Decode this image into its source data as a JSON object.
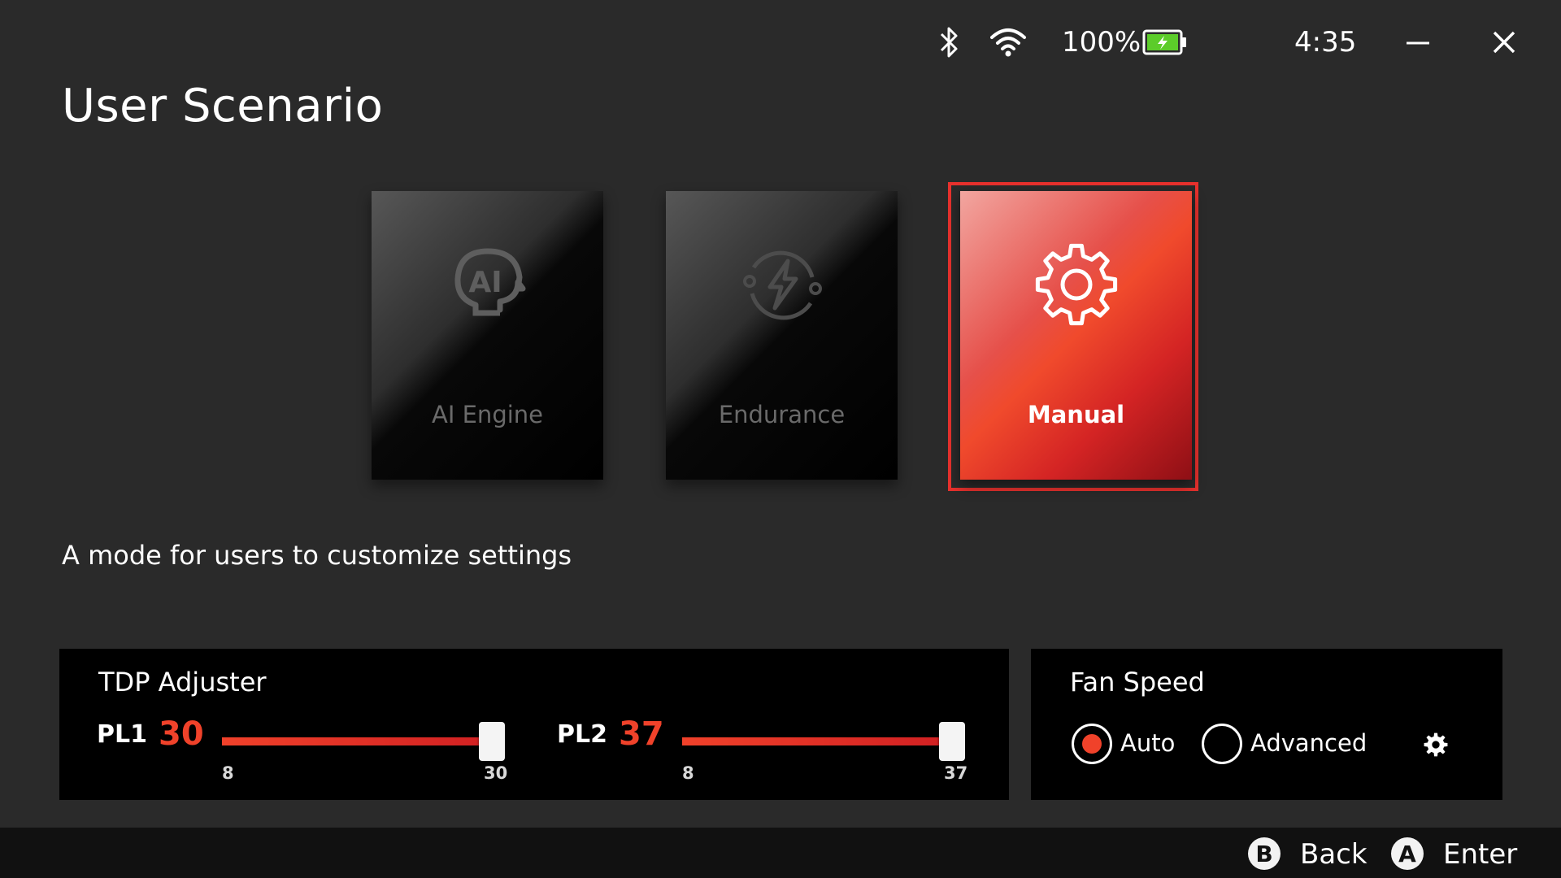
{
  "status_bar": {
    "battery_text": "100%",
    "time": "4:35",
    "icons": [
      "bluetooth-icon",
      "wifi-icon",
      "battery-charging-icon",
      "minimize-icon",
      "close-icon"
    ]
  },
  "page": {
    "title": "User Scenario",
    "description": "A mode for users to customize settings"
  },
  "modes": [
    {
      "label": "AI Engine",
      "icon": "ai-engine-icon",
      "selected": false
    },
    {
      "label": "Endurance",
      "icon": "endurance-icon",
      "selected": false
    },
    {
      "label": "Manual",
      "icon": "gear-icon",
      "selected": true
    }
  ],
  "tdp": {
    "title": "TDP Adjuster",
    "pl1": {
      "label": "PL1",
      "value": "30",
      "min": "8",
      "max": "30",
      "fraction": 1.0
    },
    "pl2": {
      "label": "PL2",
      "value": "37",
      "min": "8",
      "max": "37",
      "fraction": 1.0
    }
  },
  "fan": {
    "title": "Fan Speed",
    "options": [
      {
        "label": "Auto",
        "selected": true
      },
      {
        "label": "Advanced",
        "selected": false
      }
    ]
  },
  "footer": {
    "back_key": "B",
    "back_label": "Back",
    "enter_key": "A",
    "enter_label": "Enter"
  },
  "colors": {
    "accent": "#f0422a",
    "selection_border": "#e8312d",
    "background": "#2a2a2a",
    "panel": "#000000"
  }
}
